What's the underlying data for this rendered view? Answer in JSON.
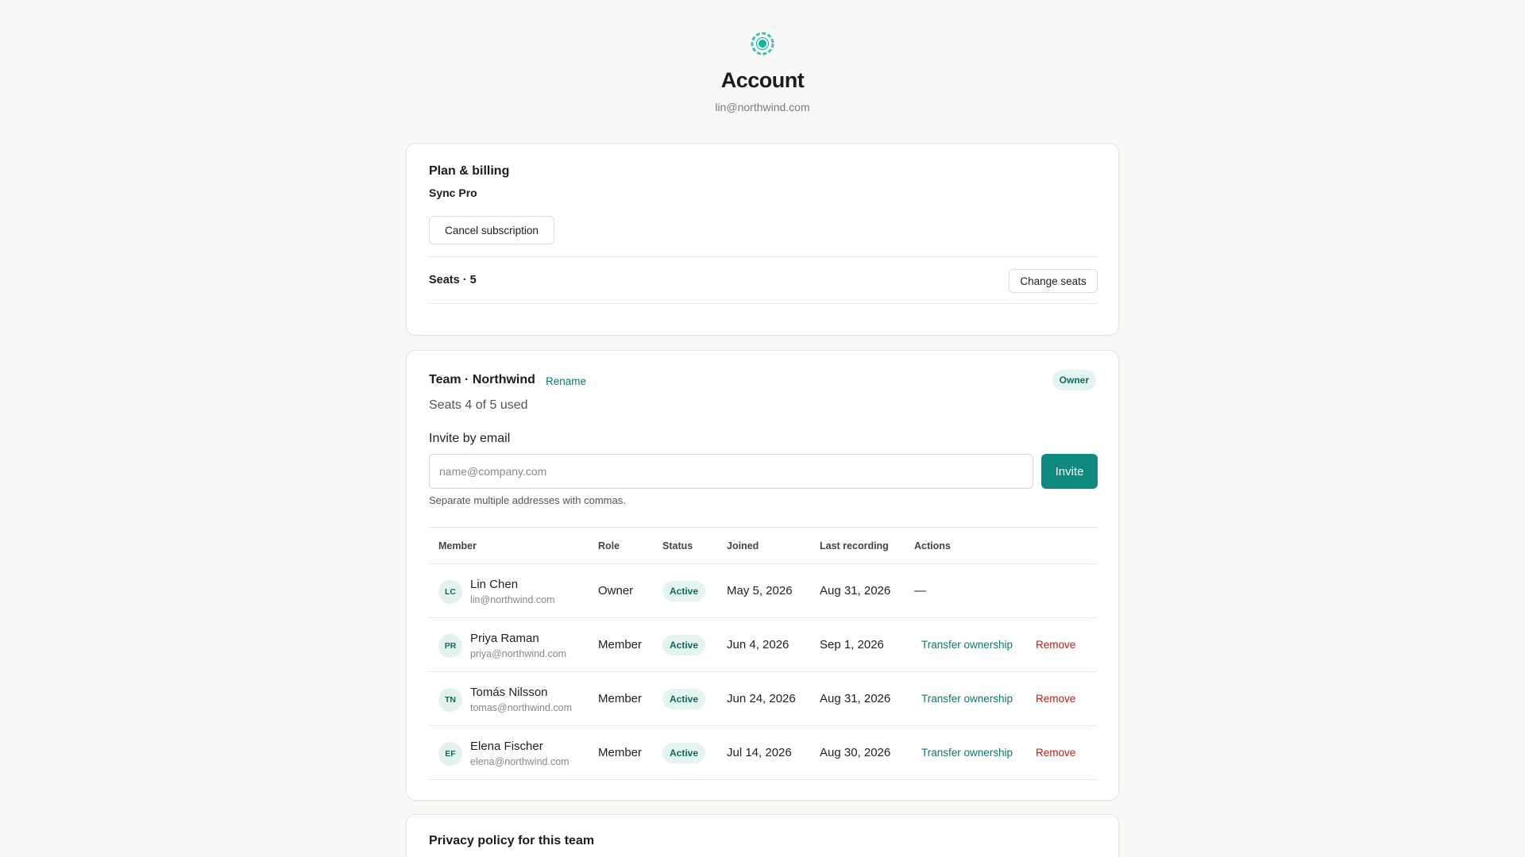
{
  "header": {
    "logo_icon": "sync-logo-icon",
    "title": "Account",
    "email": "lin@northwind.com"
  },
  "plan_billing": {
    "title": "Plan & billing",
    "plan_name": "Sync Pro",
    "cancel_label": "Cancel subscription",
    "seats_label": "Seats · 5",
    "change_seats_label": "Change seats"
  },
  "team": {
    "title": "Team · Northwind",
    "rename_label": "Rename",
    "role_badge": "Owner",
    "seats_used": "Seats 4 of 5 used",
    "invite_label": "Invite by email",
    "invite_placeholder": "name@company.com",
    "invite_button": "Invite",
    "invite_hint": "Separate multiple addresses with commas.",
    "columns": [
      "Member",
      "Role",
      "Status",
      "Joined",
      "Last recording",
      "Actions"
    ],
    "members": [
      {
        "initials": "LC",
        "name": "Lin Chen",
        "email": "lin@northwind.com",
        "role": "Owner",
        "status": "Active",
        "joined": "May 5, 2026",
        "last_recording": "Aug 31, 2026",
        "actions_placeholder": "—"
      },
      {
        "initials": "PR",
        "name": "Priya Raman",
        "email": "priya@northwind.com",
        "role": "Member",
        "status": "Active",
        "joined": "Jun 4, 2026",
        "last_recording": "Sep 1, 2026",
        "transfer": "Transfer ownership",
        "remove": "Remove"
      },
      {
        "initials": "TN",
        "name": "Tomás Nilsson",
        "email": "tomas@northwind.com",
        "role": "Member",
        "status": "Active",
        "joined": "Jun 24, 2026",
        "last_recording": "Aug 31, 2026",
        "transfer": "Transfer ownership",
        "remove": "Remove"
      },
      {
        "initials": "EF",
        "name": "Elena Fischer",
        "email": "elena@northwind.com",
        "role": "Member",
        "status": "Active",
        "joined": "Jul 14, 2026",
        "last_recording": "Aug 30, 2026",
        "transfer": "Transfer ownership",
        "remove": "Remove"
      }
    ]
  },
  "privacy": {
    "title": "Privacy policy for this team"
  },
  "colors": {
    "accent": "#0f8a7e",
    "accent_text": "#0f766e",
    "danger": "#b42318",
    "badge_bg": "#e4f4f0",
    "page_bg": "#f9f8f6"
  }
}
